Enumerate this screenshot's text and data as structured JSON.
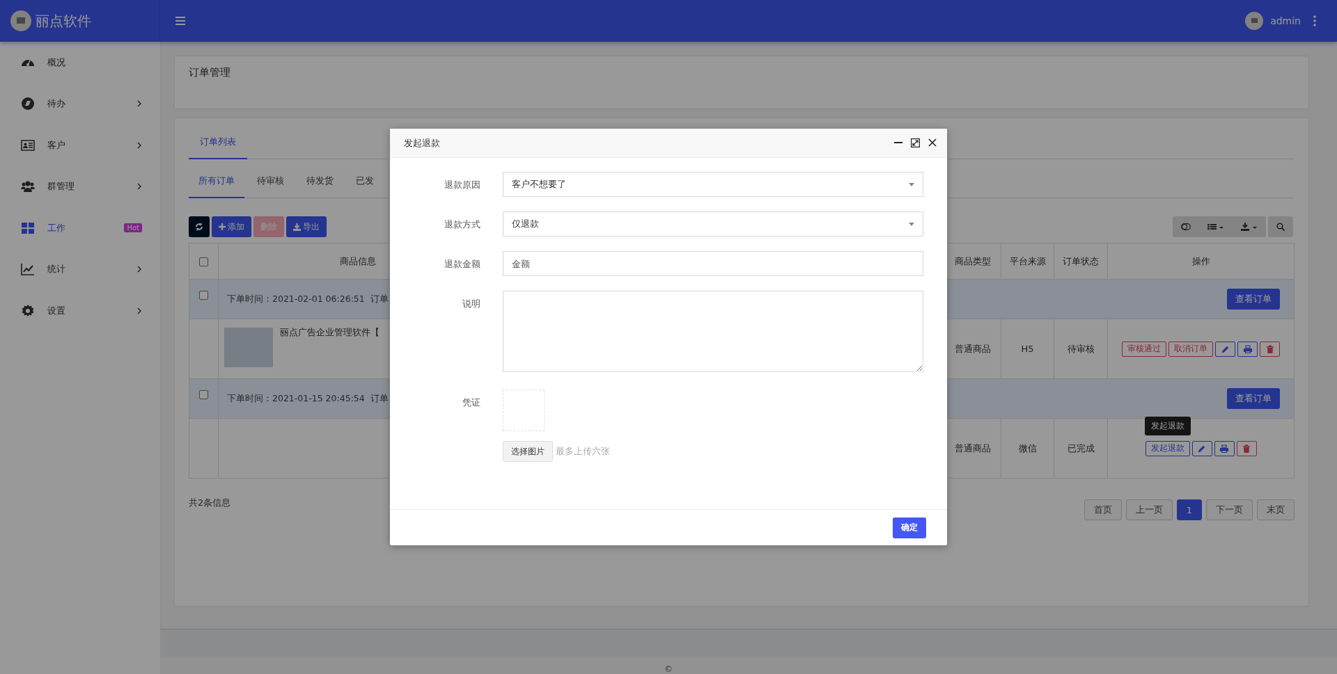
{
  "app": {
    "logo_text": "丽点软件",
    "user": "admin"
  },
  "sidebar": {
    "items": [
      {
        "kind": "dashboard",
        "label": "概况",
        "has_children": false,
        "selected": false
      },
      {
        "kind": "todo",
        "label": "待办",
        "has_children": true,
        "selected": false
      },
      {
        "kind": "customer",
        "label": "客户",
        "has_children": true,
        "selected": false
      },
      {
        "kind": "group",
        "label": "群管理",
        "has_children": true,
        "selected": false
      },
      {
        "kind": "work",
        "label": "工作",
        "has_children": false,
        "selected": true,
        "badge": "Hot"
      },
      {
        "kind": "stats",
        "label": "统计",
        "has_children": true,
        "selected": false
      },
      {
        "kind": "settings",
        "label": "设置",
        "has_children": true,
        "selected": false
      }
    ]
  },
  "page_title": "订单管理",
  "tabs": [
    {
      "label": "订单列表",
      "selected": true
    }
  ],
  "subtabs": [
    {
      "label": "所有订单",
      "selected": true
    },
    {
      "label": "待审核",
      "selected": false
    },
    {
      "label": "待发货",
      "selected": false
    },
    {
      "label": "已发",
      "selected": false
    }
  ],
  "toolbar": {
    "buttons": [
      {
        "kind": "refresh"
      },
      {
        "kind": "add",
        "label": "添加"
      },
      {
        "kind": "delete",
        "label": "删除",
        "disabled": true
      },
      {
        "kind": "export",
        "label": "导出"
      }
    ],
    "tools": [
      {
        "kind": "toggle"
      },
      {
        "kind": "columns"
      },
      {
        "kind": "download"
      },
      {
        "kind": "search"
      }
    ]
  },
  "table": {
    "header_checkbox": {
      "checked": false
    },
    "columns": [
      {
        "label": "商品信息"
      },
      {
        "label": "商品类型"
      },
      {
        "label": "平台来源"
      },
      {
        "label": "订单状态"
      },
      {
        "label": "操作"
      }
    ],
    "orders": [
      {
        "checked": false,
        "order_time": "下单时间：2021-02-01 06:26:51",
        "order_no_label": "订单",
        "view_button": "查看订单",
        "product_name": "丽点广告企业管理软件【",
        "has_image": true,
        "type": "普通商品",
        "source": "H5",
        "status": "待审核",
        "actions": [
          {
            "kind": "approve",
            "label": "审核通过"
          },
          {
            "kind": "cancel",
            "label": "取消订单"
          },
          {
            "kind": "edit"
          },
          {
            "kind": "print"
          },
          {
            "kind": "delete"
          }
        ]
      },
      {
        "checked": false,
        "order_time": "下单时间：2021-01-15 20:45:54",
        "order_no_label": "订单",
        "view_button": "查看订单",
        "has_image": false,
        "type": "普通商品",
        "source": "微信",
        "status": "已完成",
        "actions": [
          {
            "kind": "refund",
            "label": "发起退款",
            "tooltip": "发起退款"
          },
          {
            "kind": "edit"
          },
          {
            "kind": "print"
          },
          {
            "kind": "delete"
          }
        ]
      }
    ]
  },
  "summary": "共2条信息",
  "pagination": [
    {
      "label": "首页",
      "selected": false
    },
    {
      "label": "上一页",
      "selected": false
    },
    {
      "label": "1",
      "selected": true
    },
    {
      "label": "下一页",
      "selected": false
    },
    {
      "label": "末页",
      "selected": false
    }
  ],
  "copyright": "©",
  "modal": {
    "title": "发起退款",
    "fields": [
      {
        "kind": "select",
        "label": "退款原因",
        "value": "客户不想要了"
      },
      {
        "kind": "select",
        "label": "退款方式",
        "value": "仅退款"
      },
      {
        "kind": "input",
        "label": "退款金额",
        "placeholder": "金额"
      },
      {
        "kind": "textarea",
        "label": "说明"
      },
      {
        "kind": "upload",
        "label": "凭证",
        "button": "选择图片",
        "hint": "最多上传六张"
      }
    ],
    "confirm": "确定"
  }
}
